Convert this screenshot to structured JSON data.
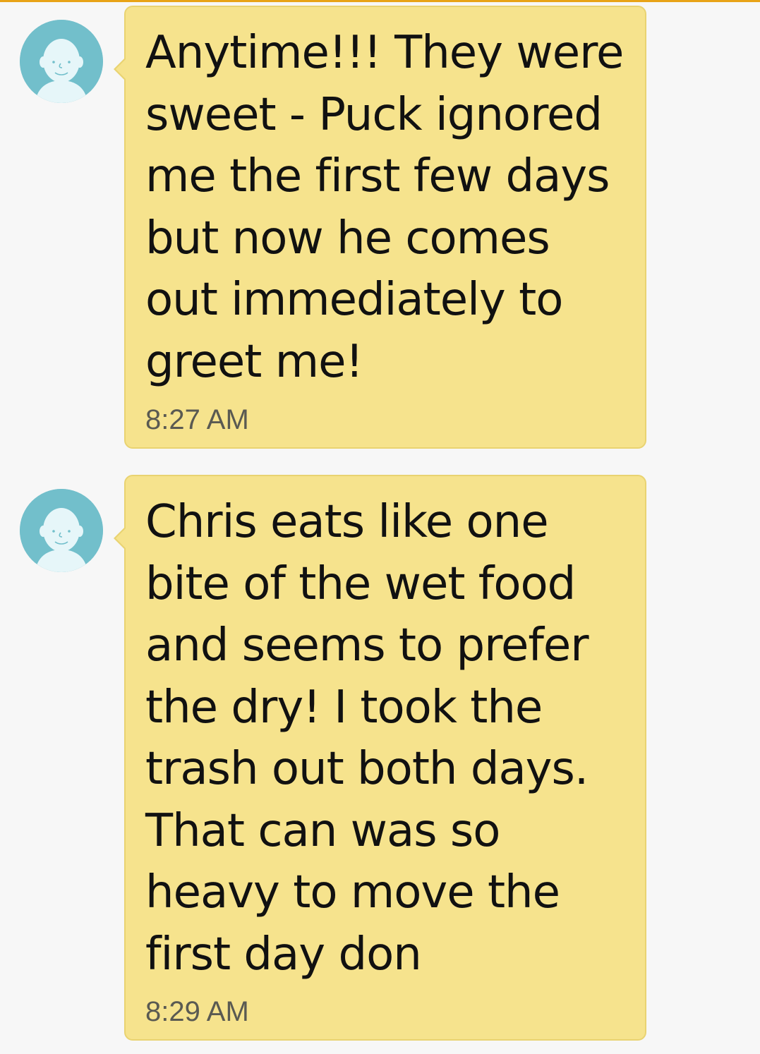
{
  "colors": {
    "background": "#f7f7f7",
    "bubble": "#f6e38d",
    "bubble_border": "#e9d371",
    "avatar": "#72bfcb",
    "accent_line": "#e8a317",
    "text": "#111111",
    "time": "#5a5a52"
  },
  "messages": [
    {
      "avatar_icon": "default-contact-avatar-icon",
      "text": "Anytime!!!  They were\nsweet - Puck ignored\nme the first few days\nbut now he comes\nout immediately to\ngreet me!",
      "time": "8:27 AM"
    },
    {
      "avatar_icon": "default-contact-avatar-icon",
      "text": "Chris eats like one\nbite of  the wet food\nand seems to prefer\nthe dry!   I took the\ntrash out both days.\nThat can was so\nheavy to move the\nfirst day don",
      "time": "8:29 AM"
    }
  ]
}
